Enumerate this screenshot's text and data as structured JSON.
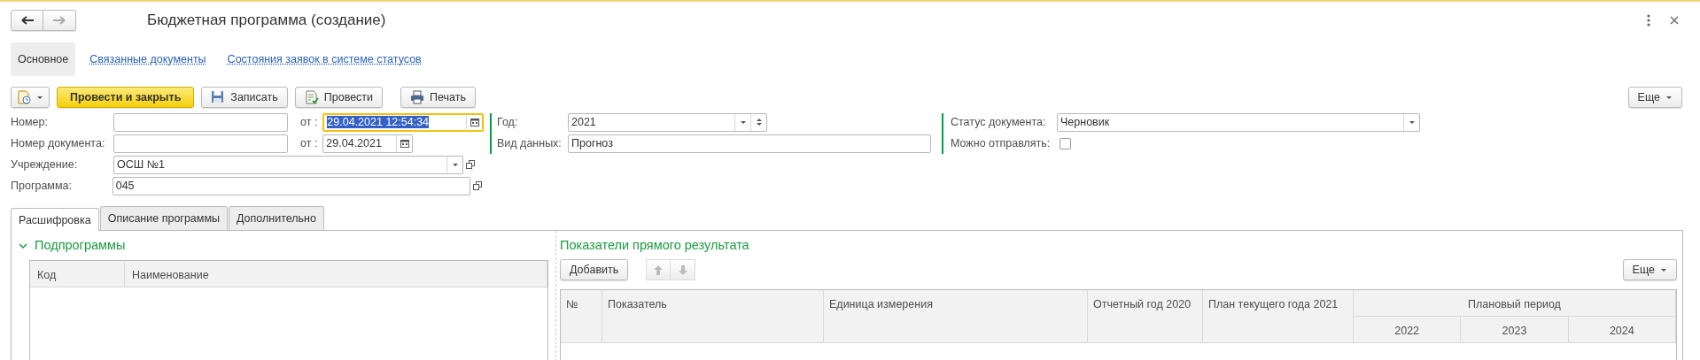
{
  "window": {
    "title": "Бюджетная программа (создание)"
  },
  "nav_tabs": [
    {
      "label": "Основное",
      "selected": true
    },
    {
      "label": "Связанные документы",
      "selected": false
    },
    {
      "label": "Состояния заявок в системе статусов",
      "selected": false
    }
  ],
  "toolbar": {
    "buttons": [
      {
        "label": "Провести и закрыть",
        "kind": "primary"
      },
      {
        "label": "Записать",
        "kind": "save"
      },
      {
        "label": "Провести",
        "kind": "post"
      },
      {
        "label": "Печать",
        "kind": "print"
      }
    ],
    "more": "Еще"
  },
  "number": {
    "label": "Номер:",
    "date_label": "от :",
    "date": "29.04.2021 12:54:34",
    "date_selected": true
  },
  "doc_number": {
    "label": "Номер документа:",
    "date_label": "от :",
    "date": "29.04.2021",
    "date_selected": false
  },
  "institution": {
    "label": "Учреждение:",
    "value": "ОСШ №1"
  },
  "program": {
    "label": "Программа:",
    "value": "045"
  },
  "year": {
    "label": "Год:",
    "value": "2021"
  },
  "data_kind": {
    "label": "Вид данных:",
    "value": "Прогноз"
  },
  "status": {
    "label": "Статус документа:",
    "value": "Черновик"
  },
  "can_send": {
    "label": "Можно отправлять:",
    "checked": false
  },
  "tabs": [
    {
      "label": "Расшифровка",
      "selected": true
    },
    {
      "label": "Описание программы",
      "selected": false
    },
    {
      "label": "Дополнительно",
      "selected": false
    }
  ],
  "subprograms": {
    "title": "Подпрограммы",
    "expanded": true,
    "columns": [
      "Код",
      "Наименование"
    ]
  },
  "results": {
    "title": "Показатели прямого результата",
    "add_button": "Добавить",
    "more": "Еще",
    "columns": [
      {
        "label": "№"
      },
      {
        "label": "Показатель"
      },
      {
        "label": "Единица измерения"
      },
      {
        "label": "Отчетный год 2020"
      },
      {
        "label": "План текущего года 2021"
      },
      {
        "label": "Плановый период",
        "children": [
          "2022",
          "2023",
          "2024"
        ]
      }
    ]
  }
}
